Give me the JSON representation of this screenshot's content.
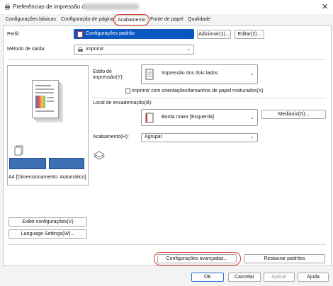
{
  "window": {
    "title": "Preferências de impressão de",
    "close_label": "✕"
  },
  "tabs": [
    {
      "label": "Configurações básicas"
    },
    {
      "label": "Configuração de página"
    },
    {
      "label": "Acabamento"
    },
    {
      "label": "Fonte de papel"
    },
    {
      "label": "Qualidade"
    }
  ],
  "profile": {
    "label": "Perfil:",
    "value": "Configurações padrão",
    "add_button": "Adicionar(1)...",
    "edit_button": "Editar(2)..."
  },
  "output": {
    "label": "Método de saída:",
    "value": "Imprimir"
  },
  "preview": {
    "caption": "A4 [Dimensionamento: Automático]"
  },
  "print_style": {
    "label": "Estilo de impressão(Y):",
    "value": "Impressão dos dois lados",
    "mixed_label": "Imprimir com orientações/tamanhos de papel misturados(X)"
  },
  "binding": {
    "label": "Local de encadernação(B):",
    "value": "Borda maior [Esquerda]",
    "margin_button": "Medianiz(G)..."
  },
  "finishing": {
    "label": "Acabamento(H):",
    "value": "Agrupar"
  },
  "left_buttons": {
    "show_settings": "Exibir configurações(V)",
    "language": "Language Settings(W)..."
  },
  "bottom": {
    "advanced": "Configurações avançadas...",
    "restore": "Restaurar padrões",
    "ok": "OK",
    "cancel": "Cancelar",
    "apply": "Aplicar",
    "help": "Ajuda"
  },
  "colors": {
    "selection": "#0a57c2",
    "highlight_circle": "#d23a2c"
  }
}
